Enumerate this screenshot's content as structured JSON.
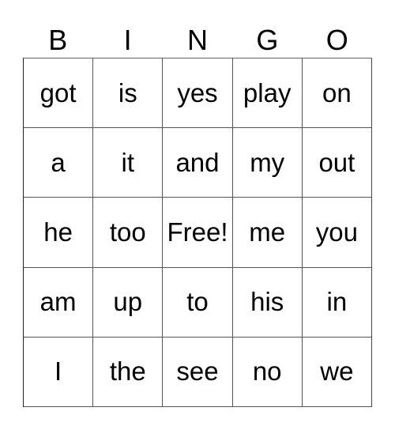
{
  "header": [
    "B",
    "I",
    "N",
    "G",
    "O"
  ],
  "board": [
    [
      "got",
      "is",
      "yes",
      "play",
      "on"
    ],
    [
      "a",
      "it",
      "and",
      "my",
      "out"
    ],
    [
      "he",
      "too",
      "Free!",
      "me",
      "you"
    ],
    [
      "am",
      "up",
      "to",
      "his",
      "in"
    ],
    [
      "I",
      "the",
      "see",
      "no",
      "we"
    ]
  ]
}
